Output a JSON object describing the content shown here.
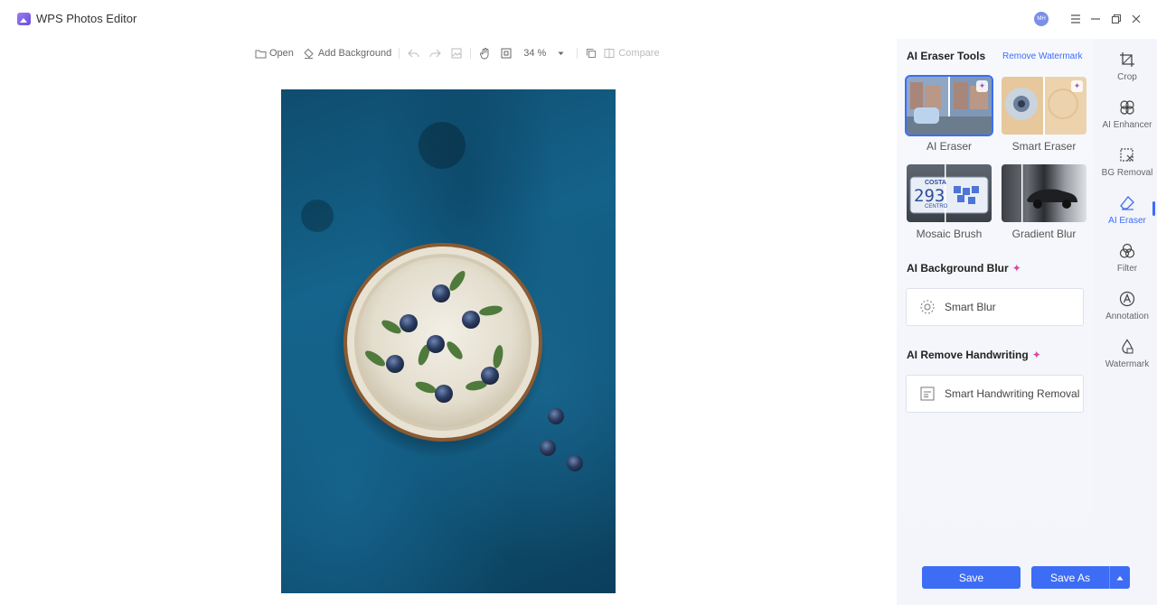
{
  "window": {
    "title": "WPS Photos Editor",
    "avatar_initials": "MH"
  },
  "toolbar": {
    "open_label": "Open",
    "add_background_label": "Add Background",
    "zoom_value": "34 %",
    "compare_label": "Compare"
  },
  "panel": {
    "eraser_section_title": "AI Eraser Tools",
    "remove_watermark_link": "Remove Watermark",
    "tools": [
      {
        "label": "AI Eraser",
        "badge": "✦"
      },
      {
        "label": "Smart Eraser",
        "badge": "✦"
      },
      {
        "label": "Mosaic Brush",
        "plate_text": "COSTA",
        "plate_number": "293",
        "plate_bottom": "CENTRO"
      },
      {
        "label": "Gradient Blur"
      }
    ],
    "bg_blur_title": "AI Background Blur",
    "smart_blur_label": "Smart Blur",
    "handwriting_title": "AI Remove Handwriting",
    "handwriting_button_label": "Smart Handwriting Removal",
    "sparkle": "✦"
  },
  "rail": {
    "items": [
      {
        "label": "Crop",
        "icon": "crop-icon"
      },
      {
        "label": "AI Enhancer",
        "icon": "ai-enhancer-icon"
      },
      {
        "label": "BG Removal",
        "icon": "bg-removal-icon"
      },
      {
        "label": "AI Eraser",
        "icon": "eraser-icon",
        "active": true
      },
      {
        "label": "Filter",
        "icon": "filter-icon"
      },
      {
        "label": "Annotation",
        "icon": "annotation-icon"
      },
      {
        "label": "Watermark",
        "icon": "watermark-icon"
      }
    ]
  },
  "footer": {
    "save_label": "Save",
    "save_as_label": "Save As"
  },
  "colors": {
    "accent": "#3d6df5",
    "sparkle": "#e0479e"
  }
}
